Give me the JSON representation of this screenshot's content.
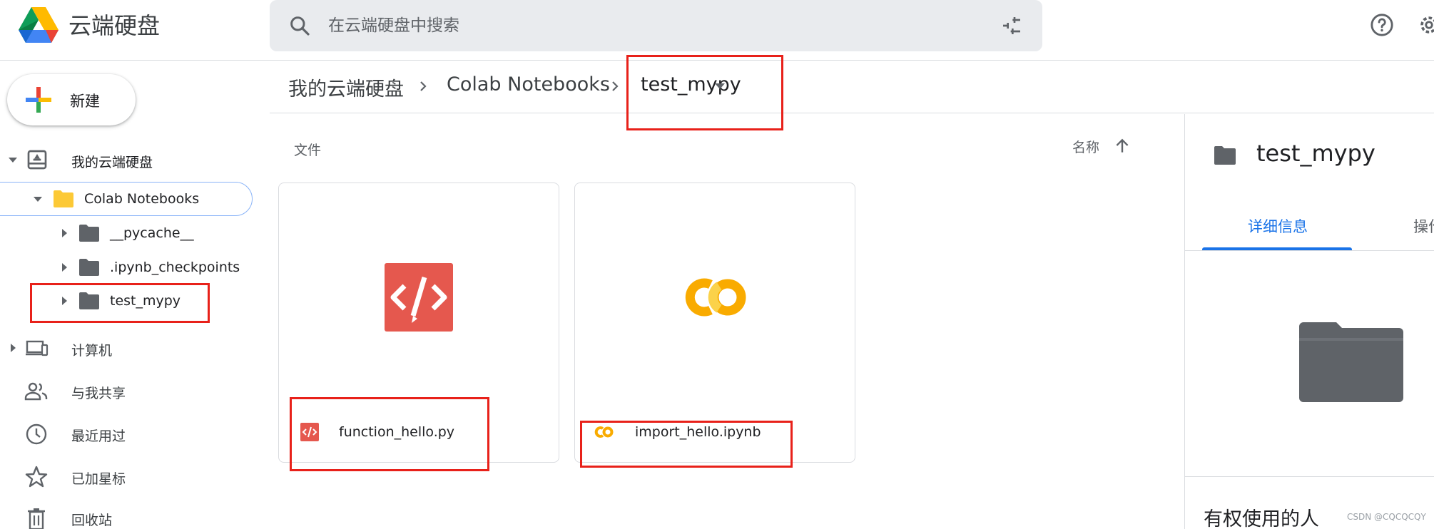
{
  "header": {
    "product_name": "云端硬盘",
    "search_placeholder": "在云端硬盘中搜索"
  },
  "sidebar": {
    "new_label": "新建",
    "tree": {
      "root": "我的云端硬盘",
      "colab": "Colab Notebooks",
      "children": [
        "__pycache__",
        ".ipynb_checkpoints",
        "test_mypy"
      ]
    },
    "nav": [
      "计算机",
      "与我共享",
      "最近用过",
      "已加星标",
      "回收站"
    ]
  },
  "breadcrumb": {
    "items": [
      "我的云端硬盘",
      "Colab Notebooks",
      "test_mypy"
    ]
  },
  "main": {
    "section_title": "文件",
    "sort_label": "名称",
    "files": [
      {
        "name": "function_hello.py",
        "type": "python-code"
      },
      {
        "name": "import_hello.ipynb",
        "type": "colab-notebook"
      }
    ]
  },
  "details": {
    "title": "test_mypy",
    "tabs": [
      "详细信息",
      "操作"
    ],
    "people_heading": "有权使用的人"
  },
  "watermark": "CSDN @CQCQCQY",
  "colors": {
    "accent": "#1a73e8",
    "highlight_box": "#e8211a",
    "code_icon": "#e5584e",
    "colab_yellow": "#f9ab00",
    "folder_grey": "#5f6368"
  }
}
